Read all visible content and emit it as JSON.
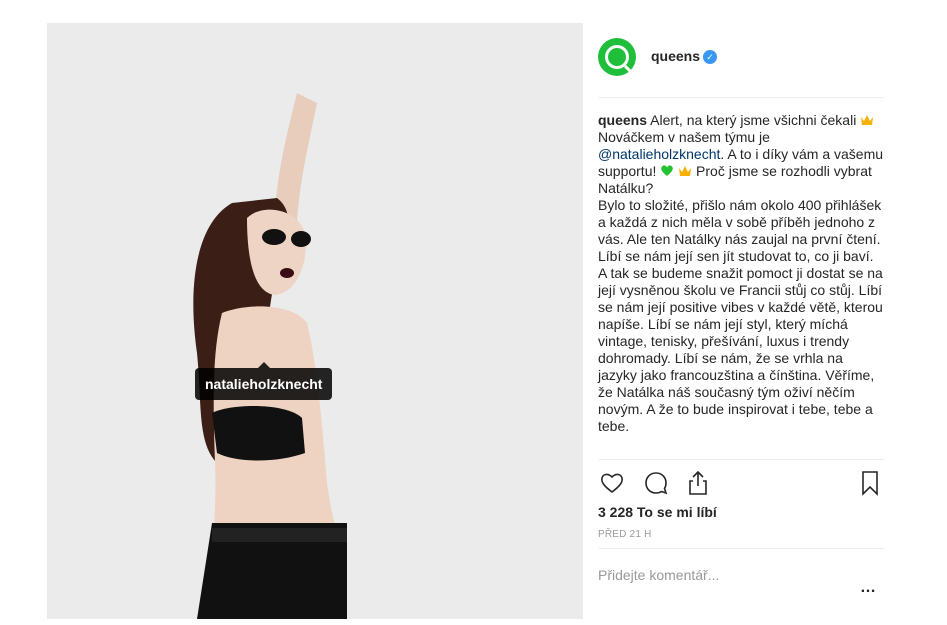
{
  "post": {
    "image_tag": "natalieholzknecht",
    "author": {
      "username": "queens",
      "verified": true,
      "avatar_color": "#1fbf3b"
    },
    "caption": {
      "username": "queens",
      "part1": " Alert, na který jsme všichni čekali ",
      "part2": " Nováčkem v našem týmu je ",
      "mention": "@natalieholzknecht",
      "part3": ". A to i díky vám a vašemu supportu! ",
      "part4": " Proč jsme se rozhodli vybrat Natálku?",
      "body": "Bylo to složité, přišlo nám okolo 400 přihlášek a každá z nich měla v sobě příběh jednoho z vás. Ale ten Natálky nás zaujal na první čtení. Líbí se nám její sen jít studovat to, co ji baví. A tak se budeme snažit pomoct ji dostat se na její vysněnou školu ve Francii stůj co stůj. Líbí se nám její positive vibes v každé větě, kterou napíše. Líbí se nám její styl, který míchá vintage, tenisky, přešívání, luxus i trendy dohromady. Líbí se nám, že se vrhla na jazyky jako francouzština a čínština. Věříme, že Natálka náš současný tým oživí něčím novým. A že to bude inspirovat i tebe, tebe a tebe."
    },
    "emojis": [
      "crown-emoji",
      "green-heart-emoji",
      "crown-emoji"
    ],
    "likes": "3 228 To se mi líbí",
    "time": "PŘED 21 H",
    "comment_placeholder": "Přidejte komentář...",
    "more_label": "…",
    "icons": [
      "heart-icon",
      "comment-icon",
      "share-icon",
      "bookmark-icon"
    ],
    "colors": {
      "link": "#003569",
      "verified": "#3897f0",
      "muted": "#999999"
    }
  }
}
